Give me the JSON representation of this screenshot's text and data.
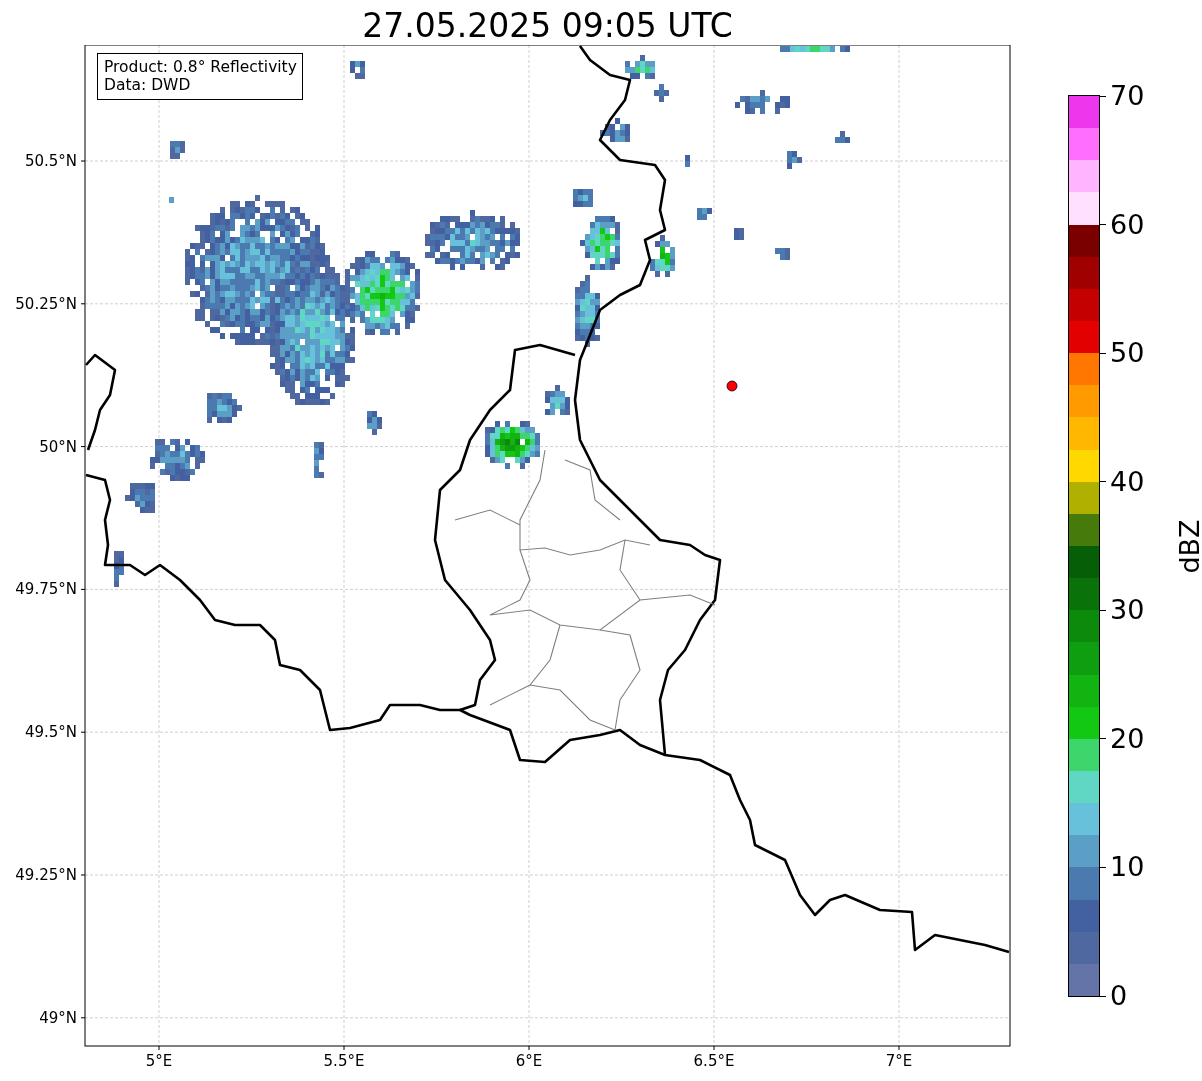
{
  "title": "27.05.2025 09:05 UTC",
  "info_box": [
    "Product: 0.8° Reflectivity",
    "Data: DWD"
  ],
  "map": {
    "xticks": [
      "5°E",
      "5.5°E",
      "6°E",
      "6.5°E",
      "7°E"
    ],
    "yticks": [
      "50.5°N",
      "50.25°N",
      "50°N",
      "49.75°N",
      "49.5°N",
      "49.25°N",
      "49°N"
    ]
  },
  "colorbar": {
    "label": "dBZ",
    "ticks": [
      "70",
      "60",
      "50",
      "40",
      "30",
      "20",
      "10",
      "0"
    ],
    "bins": [
      {
        "color": "#6474a8"
      },
      {
        "color": "#5068a0"
      },
      {
        "color": "#4360a0"
      },
      {
        "color": "#4a7ab0"
      },
      {
        "color": "#5b9ec6"
      },
      {
        "color": "#67c1db"
      },
      {
        "color": "#60d6c4"
      },
      {
        "color": "#3dd66c"
      },
      {
        "color": "#13c813"
      },
      {
        "color": "#11b411"
      },
      {
        "color": "#0f9e0f"
      },
      {
        "color": "#0c8a0c"
      },
      {
        "color": "#097209"
      },
      {
        "color": "#065e06"
      },
      {
        "color": "#467a0a"
      },
      {
        "color": "#b0b000"
      },
      {
        "color": "#ffd800"
      },
      {
        "color": "#ffb700"
      },
      {
        "color": "#ff9a00"
      },
      {
        "color": "#ff7700"
      },
      {
        "color": "#e30000"
      },
      {
        "color": "#c40000"
      },
      {
        "color": "#a00000"
      },
      {
        "color": "#7a0000"
      },
      {
        "color": "#ffe1ff"
      },
      {
        "color": "#ffb4ff"
      },
      {
        "color": "#ff6eff"
      },
      {
        "color": "#ec37ec"
      }
    ]
  }
}
